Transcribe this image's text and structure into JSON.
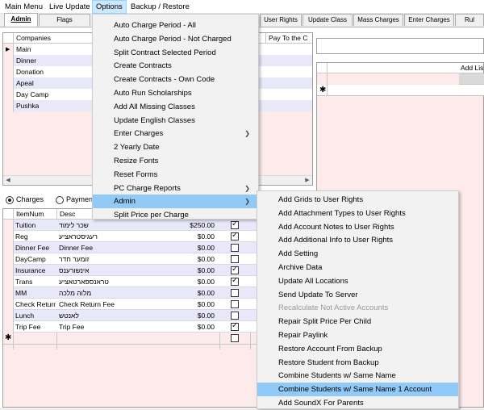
{
  "menubar": {
    "items": [
      "Main Menu",
      "Live Update",
      "Options",
      "Backup / Restore"
    ]
  },
  "tabs": [
    "Admin",
    "Flags",
    "User Rights",
    "Update Class",
    "Mass Charges",
    "Enter Charges",
    "Rul"
  ],
  "companies": {
    "header": "Companies",
    "header_right": "Pay To the C",
    "rows": [
      "Main",
      "Dinner",
      "Donation",
      "Apeal",
      "Day Camp",
      "Pushka"
    ]
  },
  "right_panel": {
    "header": "Add Lis",
    "new_row_marker": "✱"
  },
  "radios": {
    "charges": "Charges",
    "payment": "Payment"
  },
  "items": {
    "headers": [
      "ItemNum",
      "Desc"
    ],
    "rows": [
      {
        "num": "Tuition",
        "desc": "שכר לימוד",
        "amount": "$250.00",
        "checked": true
      },
      {
        "num": "Reg",
        "desc": "רעגיסטראציע",
        "amount": "$0.00",
        "checked": true
      },
      {
        "num": "Dinner Fee",
        "desc": "Dinner Fee",
        "amount": "$0.00",
        "checked": false
      },
      {
        "num": "DayCamp",
        "desc": "זומער חדר",
        "amount": "$0.00",
        "checked": false
      },
      {
        "num": "Insurance",
        "desc": "אינשורענס",
        "amount": "$0.00",
        "checked": true
      },
      {
        "num": "Trans",
        "desc": "טראנספארטאציע",
        "amount": "$0.00",
        "checked": true
      },
      {
        "num": "MM",
        "desc": "מלוה מלכה",
        "amount": "$0.00",
        "checked": false
      },
      {
        "num": "Check Return",
        "desc": "Check Return Fee",
        "amount": "$0.00",
        "checked": false
      },
      {
        "num": "Lunch",
        "desc": "לאנטש",
        "amount": "$0.00",
        "checked": false
      },
      {
        "num": "Trip Fee",
        "desc": "Trip Fee",
        "amount": "$0.00",
        "checked": true
      }
    ],
    "new_row_marker": "✱"
  },
  "options_menu": {
    "items": [
      {
        "label": "Auto Charge Period - All",
        "submenu": false
      },
      {
        "label": "Auto Charge Period - Not Charged",
        "submenu": false
      },
      {
        "label": "Split Contract Selected Period",
        "submenu": false
      },
      {
        "label": "Create Contracts",
        "submenu": false
      },
      {
        "label": "Create Contracts - Own Code",
        "submenu": false
      },
      {
        "label": "Auto Run Scholarships",
        "submenu": false
      },
      {
        "label": "Add All Missing Classes",
        "submenu": false
      },
      {
        "label": "Update English Classes",
        "submenu": false
      },
      {
        "label": "Enter Charges",
        "submenu": true
      },
      {
        "label": "2 Yearly Date",
        "submenu": false
      },
      {
        "label": "Resize Fonts",
        "submenu": false
      },
      {
        "label": "Reset Forms",
        "submenu": false
      },
      {
        "label": "PC Charge Reports",
        "submenu": true
      },
      {
        "label": "Admin",
        "submenu": true,
        "highlighted": true
      },
      {
        "label": "Split Price per Charge",
        "submenu": false
      }
    ]
  },
  "admin_submenu": {
    "items": [
      {
        "label": "Add Grids to User Rights"
      },
      {
        "label": "Add Attachment Types to User Rights"
      },
      {
        "label": "Add Account Notes to User Rights"
      },
      {
        "label": "Add Additional Info to User Rights"
      },
      {
        "label": "Add Setting"
      },
      {
        "label": "Archive Data"
      },
      {
        "label": "Update All Locations"
      },
      {
        "label": "Send Update To Server"
      },
      {
        "label": "Recalculate Not Active Accounts",
        "disabled": true
      },
      {
        "label": "Repair Split Price Per Child"
      },
      {
        "label": "Repair Paylink"
      },
      {
        "label": "Restore Account From Backup"
      },
      {
        "label": "Restore Student from Backup"
      },
      {
        "label": "Combine Students w/ Same Name"
      },
      {
        "label": "Combine Students w/ Same Name 1 Account",
        "highlighted": true
      },
      {
        "label": "Add SoundX For Parents"
      }
    ]
  },
  "colors": {
    "menu_highlight": "#91c9f7",
    "grid_pink": "#fdeaea",
    "row_lavender": "#e8e8f8"
  }
}
